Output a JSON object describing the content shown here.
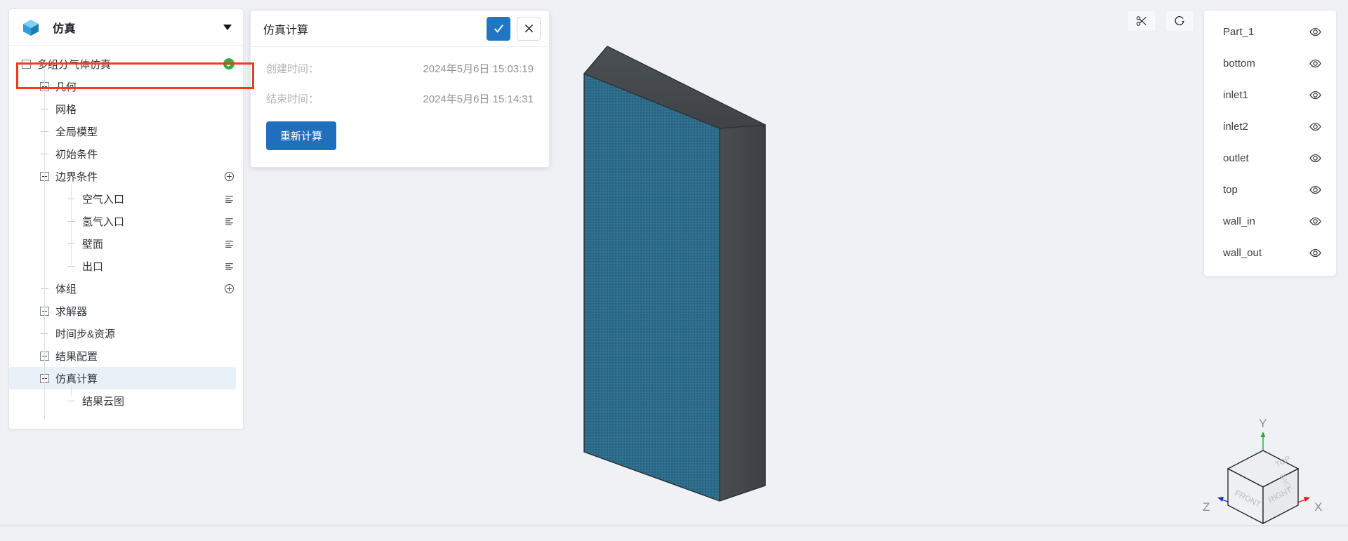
{
  "tree_panel": {
    "header": {
      "title": "仿真",
      "icon": "cube-icon",
      "caret": "chevron-down-icon"
    },
    "items": [
      {
        "label": "多组分气体仿真",
        "toggle": "minus",
        "depth": 0,
        "status": "check-badge",
        "selected": false,
        "highlighted": true
      },
      {
        "label": "几何",
        "toggle": "plus",
        "depth": 1,
        "selected": false
      },
      {
        "label": "网格",
        "toggle": "leaf",
        "depth": 1,
        "selected": false
      },
      {
        "label": "全局模型",
        "toggle": "leaf",
        "depth": 1,
        "selected": false
      },
      {
        "label": "初始条件",
        "toggle": "leaf",
        "depth": 1,
        "selected": false
      },
      {
        "label": "边界条件",
        "toggle": "minus",
        "depth": 1,
        "action": "plus-circle-icon",
        "selected": false
      },
      {
        "label": "空气入口",
        "toggle": "leaf",
        "depth": 2,
        "action": "list-icon",
        "selected": false
      },
      {
        "label": "氢气入口",
        "toggle": "leaf",
        "depth": 2,
        "action": "list-icon",
        "selected": false
      },
      {
        "label": "壁面",
        "toggle": "leaf",
        "depth": 2,
        "action": "list-icon",
        "selected": false
      },
      {
        "label": "出口",
        "toggle": "leaf",
        "depth": 2,
        "action": "list-icon",
        "selected": false
      },
      {
        "label": "体组",
        "toggle": "leaf",
        "depth": 1,
        "action": "plus-circle-icon",
        "selected": false
      },
      {
        "label": "求解器",
        "toggle": "plus",
        "depth": 1,
        "selected": false
      },
      {
        "label": "时间步&资源",
        "toggle": "leaf",
        "depth": 1,
        "selected": false
      },
      {
        "label": "结果配置",
        "toggle": "plus",
        "depth": 1,
        "selected": false
      },
      {
        "label": "仿真计算",
        "toggle": "minus",
        "depth": 1,
        "selected": true
      },
      {
        "label": "结果云图",
        "toggle": "leaf",
        "depth": 2,
        "selected": false
      }
    ]
  },
  "dialog": {
    "title": "仿真计算",
    "confirm_icon": "check-icon",
    "cancel_icon": "close-icon",
    "fields": [
      {
        "label": "创建时间：",
        "value": "2024年5月6日 15:03:19"
      },
      {
        "label": "结束时间：",
        "value": "2024年5月6日 15:14:31"
      }
    ],
    "recalc_label": "重新计算"
  },
  "viewport_tools": [
    {
      "name": "scissors-icon"
    },
    {
      "name": "rotate-icon"
    }
  ],
  "parts_panel": {
    "items": [
      {
        "name": "Part_1",
        "visibility_icon": "eye-icon"
      },
      {
        "name": "bottom",
        "visibility_icon": "eye-icon"
      },
      {
        "name": "inlet1",
        "visibility_icon": "eye-icon"
      },
      {
        "name": "inlet2",
        "visibility_icon": "eye-icon"
      },
      {
        "name": "outlet",
        "visibility_icon": "eye-icon"
      },
      {
        "name": "top",
        "visibility_icon": "eye-icon"
      },
      {
        "name": "wall_in",
        "visibility_icon": "eye-icon"
      },
      {
        "name": "wall_out",
        "visibility_icon": "eye-icon"
      }
    ]
  },
  "nav_cube": {
    "faces": {
      "top": "TOP",
      "front": "FRONT",
      "right": "RIGHT",
      "back": "BACK"
    },
    "axes": {
      "x": "X",
      "y": "Y",
      "z": "Z"
    },
    "axis_colors": {
      "x": "#d91d1d",
      "y": "#12b521",
      "z": "#1f2fd6"
    }
  },
  "colors": {
    "accent": "#2176c1",
    "highlight_box": "#f5391b",
    "status_green": "#2bb14a",
    "model_face": "#2d6c8c",
    "model_edge": "#474b4f",
    "canvas_bg": "#eff1f5"
  }
}
